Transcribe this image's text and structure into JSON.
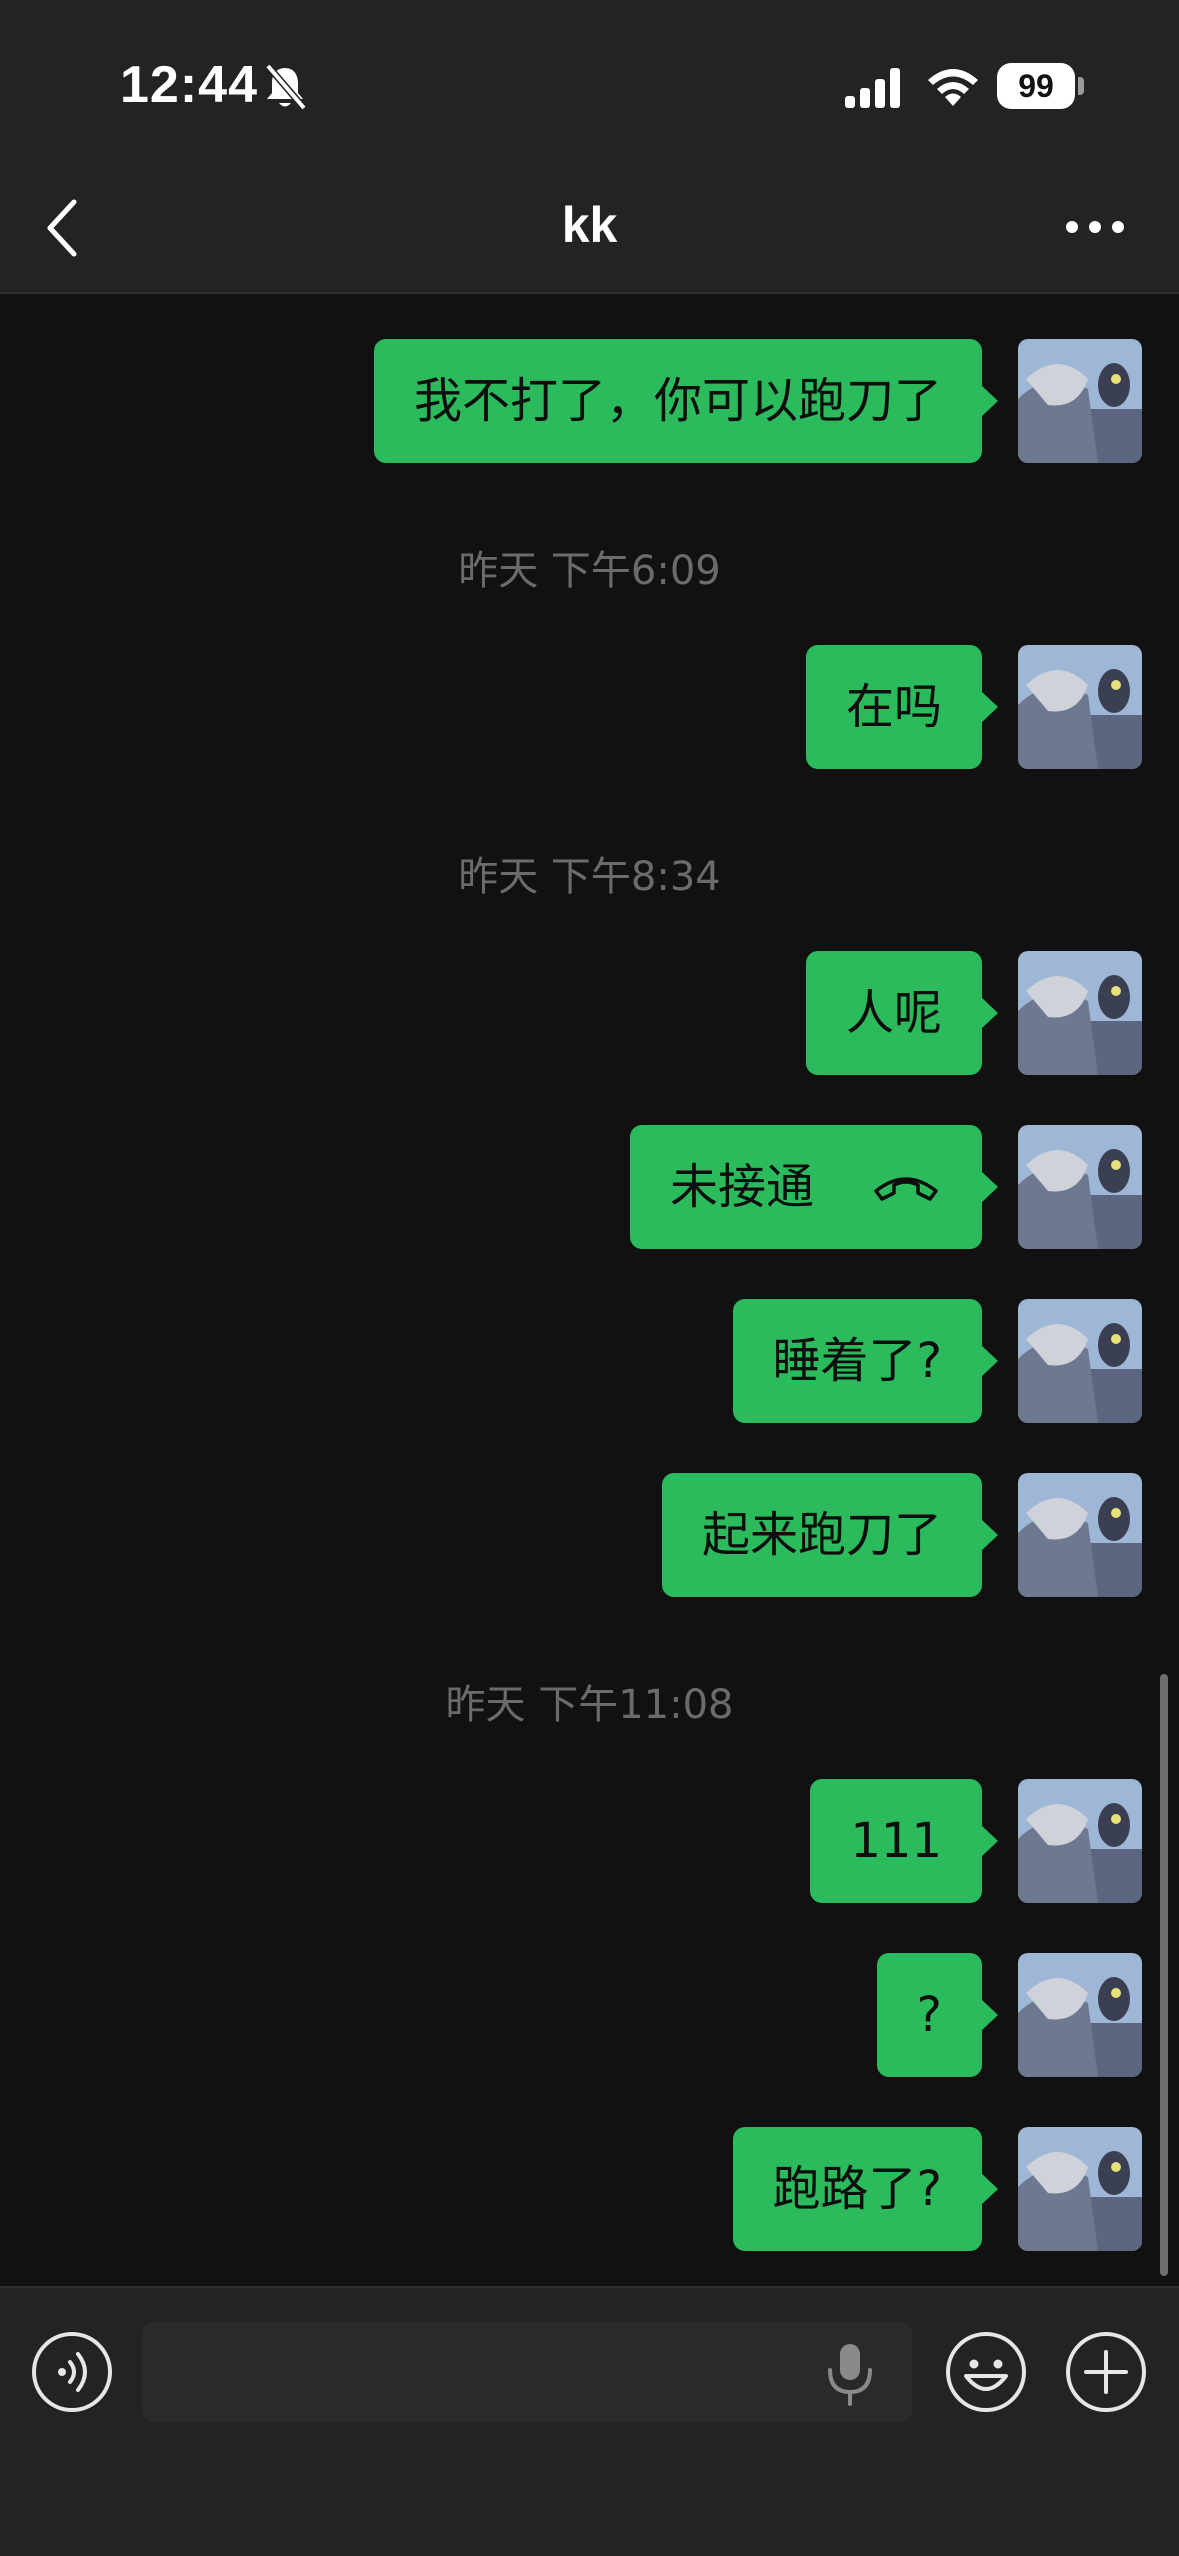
{
  "status_bar": {
    "time": "12:44",
    "battery": "99"
  },
  "header": {
    "title": "kk"
  },
  "messages": [
    {
      "type": "text",
      "text": "我不打了，你可以跑刀了"
    },
    {
      "type": "timestamp",
      "text": "昨天 下午6:09"
    },
    {
      "type": "text",
      "text": "在吗"
    },
    {
      "type": "timestamp",
      "text": "昨天 下午8:34"
    },
    {
      "type": "text",
      "text": "人呢"
    },
    {
      "type": "call",
      "text": "未接通"
    },
    {
      "type": "text",
      "text": "睡着了?"
    },
    {
      "type": "text",
      "text": "起来跑刀了"
    },
    {
      "type": "timestamp",
      "text": "昨天 下午11:08"
    },
    {
      "type": "text",
      "text": "111"
    },
    {
      "type": "text",
      "text": "?"
    },
    {
      "type": "text",
      "text": "跑路了?"
    }
  ],
  "input": {
    "value": "",
    "placeholder": ""
  },
  "colors": {
    "bubble": "#2bba5c",
    "background": "#111111",
    "bar": "#232323"
  },
  "icons": [
    "mute-icon",
    "signal-icon",
    "wifi-icon",
    "back-icon",
    "more-icon",
    "voice-icon",
    "mic-icon",
    "emoji-icon",
    "plus-icon",
    "hang-up-icon"
  ]
}
